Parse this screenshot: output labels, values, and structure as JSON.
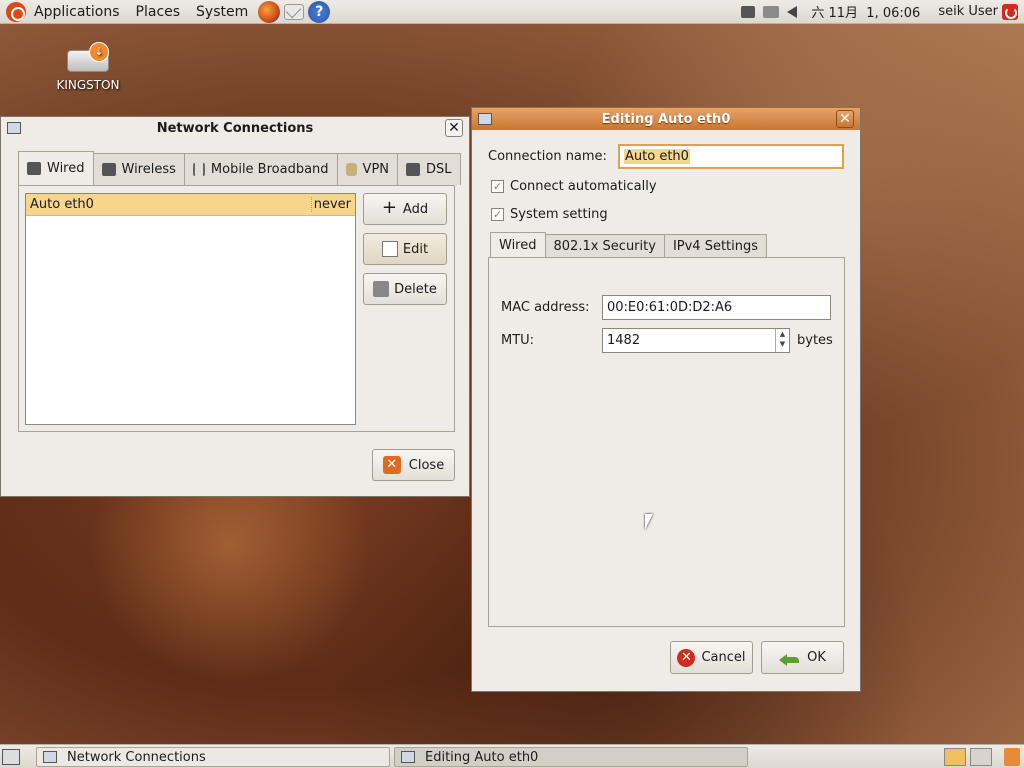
{
  "top_panel": {
    "menus": [
      "Applications",
      "Places",
      "System"
    ],
    "clock": "六 11月  1, 06:06",
    "user": "seik User"
  },
  "desktop": {
    "icons": [
      {
        "label": "KINGSTON"
      }
    ]
  },
  "network_connections": {
    "title": "Network Connections",
    "tabs": [
      {
        "label": "Wired",
        "icon": "network-wired-icon"
      },
      {
        "label": "Wireless",
        "icon": "network-wireless-icon"
      },
      {
        "label": "Mobile Broadband",
        "icon": "antenna-icon"
      },
      {
        "label": "VPN",
        "icon": "lock-icon"
      },
      {
        "label": "DSL",
        "icon": "network-dsl-icon"
      }
    ],
    "connections": [
      {
        "name": "Auto eth0",
        "last_used": "never"
      }
    ],
    "buttons": {
      "add": "Add",
      "edit": "Edit",
      "delete": "Delete",
      "close": "Close"
    }
  },
  "editing": {
    "title": "Editing Auto eth0",
    "connection_name_label": "Connection name:",
    "connection_name_value": "Auto eth0",
    "connect_automatically": {
      "label": "Connect automatically",
      "checked": true
    },
    "system_setting": {
      "label": "System setting",
      "checked": true
    },
    "tabs": [
      "Wired",
      "802.1x Security",
      "IPv4 Settings"
    ],
    "mac_label": "MAC address:",
    "mac_value": "00:E0:61:0D:D2:A6",
    "mtu_label": "MTU:",
    "mtu_value": "1482",
    "mtu_unit": "bytes",
    "cancel": "Cancel",
    "ok": "OK"
  },
  "taskbar": {
    "tasks": [
      {
        "label": "Network Connections",
        "active": false
      },
      {
        "label": "Editing Auto eth0",
        "active": true
      }
    ]
  },
  "colors": {
    "accent": "#d07a34",
    "selection": "#f6d68a",
    "title_active": "#c9762f"
  }
}
